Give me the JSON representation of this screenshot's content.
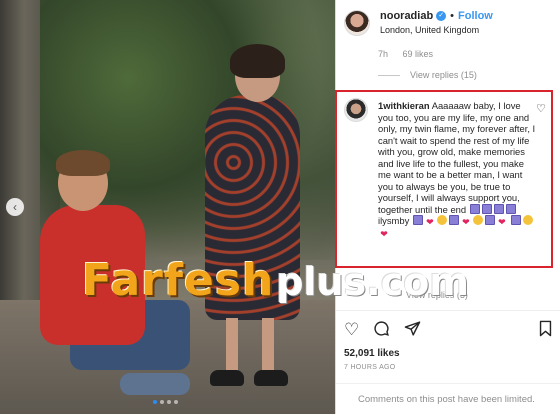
{
  "post": {
    "carousel_dots": 4,
    "active_dot": 1
  },
  "header": {
    "username": "nooradiab",
    "separator": "•",
    "follow_label": "Follow",
    "location": "London, United Kingdom"
  },
  "prev_comment": {
    "time": "7h",
    "likes": "69 likes",
    "view_replies": "View replies (15)"
  },
  "comment": {
    "username": "1withkieran",
    "text": "Aaaaaaw baby, I love you too, you are my life, my one and only, my twin flame, my forever after, I can't wait to spend the rest of my life with you, grow old, make memories and live life to the fullest, you make me want to be a better man, I want you to always be you, be true to yourself, I will always support you, together until the end",
    "tail_text": "ilysmby"
  },
  "next_replies": "View replies (3)",
  "actions": {
    "like": "heart-icon",
    "comment": "comment-icon",
    "share": "share-icon",
    "save": "bookmark-icon"
  },
  "likes_count": "52,091 likes",
  "posted_time": "7 HOURS AGO",
  "footer_text": "Comments on this post have been limited.",
  "watermark": {
    "main": "Farfesh",
    "suffix": "plus.com"
  },
  "colors": {
    "accent": "#3897f0",
    "highlight_border": "#d9232d",
    "watermark_orange": "#f2a51a"
  }
}
